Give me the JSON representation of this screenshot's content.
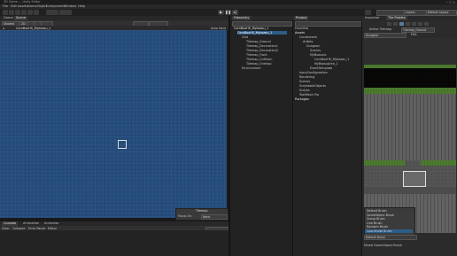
{
  "window": {
    "title": "2D Game — Unity Editor"
  },
  "menu": [
    "File",
    "Edit",
    "Assets",
    "GameObject",
    "Component",
    "Window",
    "Help"
  ],
  "toolbar": {
    "layers": "Layers",
    "layout": "Default Layout"
  },
  "tabs": {
    "game": "Game",
    "scene": "Scene",
    "console": "Console",
    "animation": "Animation",
    "animator": "Animator",
    "hierarchy": "Hierarchy",
    "project": "Project",
    "inspector": "Inspector",
    "tile_palette": "Tile Palette"
  },
  "scene_view": {
    "mode": "Shaded",
    "mode_2d": "2D",
    "breadcrumb": "CornBoxHS_Mybsasu_1",
    "auto_save": "Auto Save"
  },
  "hierarchy": {
    "items": [
      "CornBoxHS_Mybsasu_1",
      "CornBoxHS_Mybsasu_1",
      "Grid",
      "Tilemap_Ground",
      "Tilemap_Decoration1",
      "Tilemap_Decoration2",
      "Tilemap_Front",
      "Tilemap_Collision",
      "Tilemap_Overlap",
      "Environment"
    ]
  },
  "project": {
    "favorites": "Favorites",
    "tree": [
      "Assets",
      "Cornbrearts",
      "Artbits",
      "Dungeon",
      "Scenes",
      "MyBsasuro",
      "CornBoxHS_Mybsasu_1",
      "MyBsasuArea_1",
      "EventTemplate",
      "InputConfiguration",
      "Rendering",
      "Scenes",
      "ScriptableObjects",
      "Scripts",
      "TextMesh Pro",
      "Packages"
    ]
  },
  "tile_palette": {
    "active_tilemap_label": "Active Tilemap",
    "active_tilemap": "Tilemap_Ground",
    "palette": "Dungeon",
    "edit": "Edit"
  },
  "overlay": {
    "title": "Tilemap",
    "focus_on_label": "Focus On",
    "focus_on_value": "None"
  },
  "brush_menu": {
    "options": [
      "Default Brush",
      "GameObject Brush",
      "Group Brush",
      "Line Brush",
      "Random Brush",
      "Coordinate Brush"
    ],
    "selected_index": 5,
    "current": "Default Brush",
    "footer": "Mixed GameObject Brush"
  },
  "console": {
    "clear": "Clear",
    "collapse": "Collapse",
    "error_pause": "Error Pause",
    "editor": "Editor"
  }
}
